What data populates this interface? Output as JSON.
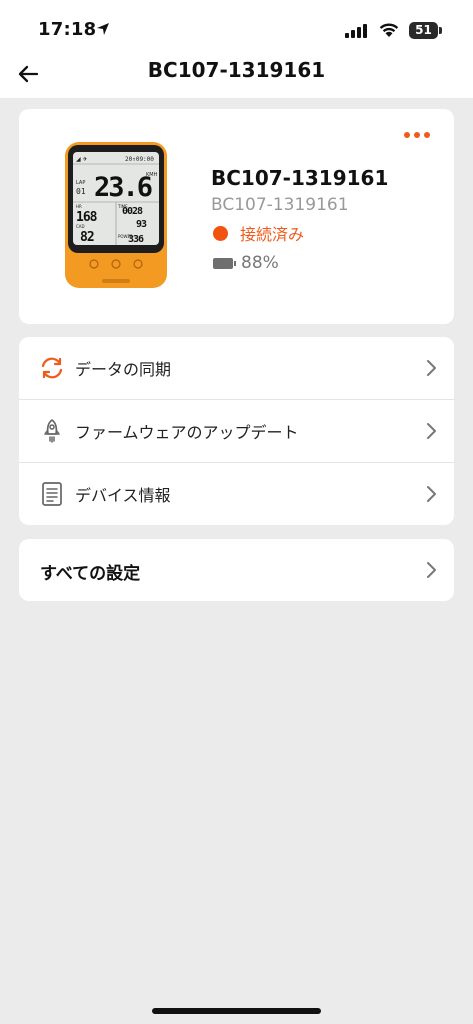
{
  "status_bar": {
    "time": "17:18",
    "battery_level": "51",
    "icons": [
      "location-arrow-icon",
      "cellular-signal-icon",
      "wifi-icon",
      "battery-icon"
    ]
  },
  "nav": {
    "title": "BC107-1319161",
    "back_icon": "back-arrow-icon"
  },
  "device": {
    "name": "BC107-1319161",
    "id": "BC107-1319161",
    "status": "接続済み",
    "battery": "88%",
    "more_icon": "more-dots-icon",
    "image": "bike-computer-image",
    "screen": {
      "speed": "23.6",
      "speed_unit": "KMH",
      "lap_label": "LAP",
      "lap": "01",
      "time_top": "20↑09:00",
      "hr_label": "HR",
      "hr": "168",
      "cad_label": "CAD",
      "cad": "82",
      "time_label": "TIME",
      "time": "0028",
      "distance": "93",
      "power_label": "POWER",
      "power": "336"
    }
  },
  "menu": {
    "items": [
      {
        "label": "データの同期",
        "icon": "sync-icon"
      },
      {
        "label": "ファームウェアのアップデート",
        "icon": "rocket-icon"
      },
      {
        "label": "デバイス情報",
        "icon": "document-icon"
      }
    ]
  },
  "settings": {
    "label": "すべての設定"
  },
  "colors": {
    "accent": "#f05a1a",
    "background": "#ebebeb",
    "card": "#ffffff",
    "device_orange": "#f39a22"
  }
}
